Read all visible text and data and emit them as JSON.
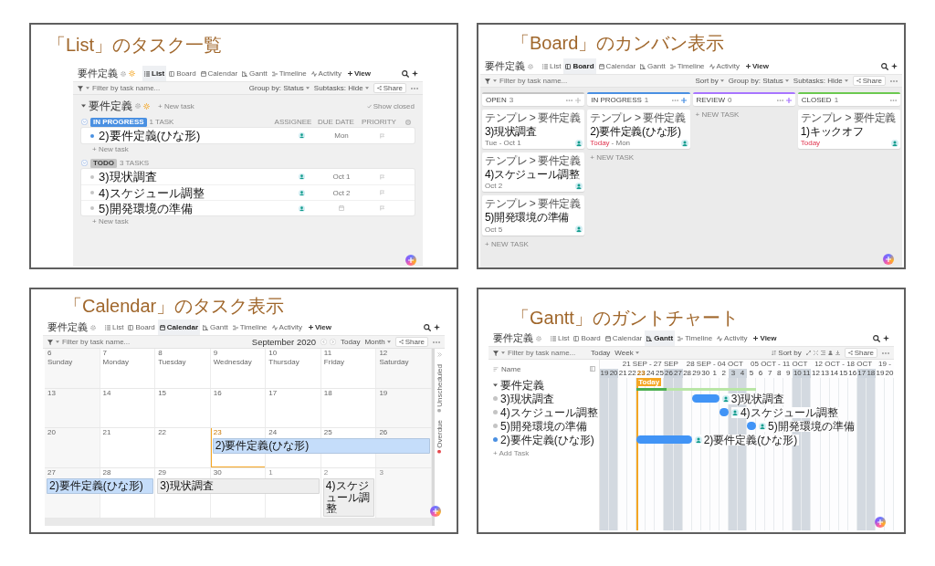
{
  "panels": [
    {
      "kind": "list",
      "title": "「List」のタスク一覧",
      "header": {
        "project": "要件定義",
        "favorite": true,
        "tabs": [
          {
            "kind": "list",
            "label": "List",
            "selected": true
          },
          {
            "kind": "board",
            "label": "Board",
            "selected": false
          },
          {
            "kind": "calendar",
            "label": "Calendar",
            "selected": false
          },
          {
            "kind": "gantt",
            "label": "Gantt",
            "selected": false
          },
          {
            "kind": "timeline",
            "label": "Timeline",
            "selected": false
          },
          {
            "kind": "activity",
            "label": "Activity",
            "selected": false
          }
        ],
        "add_view": "View"
      },
      "toolbar": {
        "filter_placeholder": "Filter by task name...",
        "right": [
          {
            "kind": "dropdown",
            "label": "Group by: Status"
          },
          {
            "kind": "dropdown",
            "label": "Subtasks: Hide"
          },
          {
            "kind": "share",
            "label": "Share"
          },
          {
            "kind": "more"
          }
        ]
      },
      "list": {
        "name": "要件定義",
        "favorite": true,
        "new_task": "+ New task",
        "show_closed": "Show closed",
        "columns": [
          "ASSIGNEE",
          "DUE DATE",
          "PRIORITY"
        ],
        "groups": [
          {
            "status": "IN PROGRESS",
            "color": "#4a90e2",
            "count": "1 TASK",
            "tasks": [
              {
                "name": "2)要件定義(ひな形)",
                "due": "Mon"
              }
            ],
            "new_task": "+ New task"
          },
          {
            "status": "TODO",
            "color": "#c4c4c4",
            "count": "3 TASKS",
            "tasks": [
              {
                "name": "3)現状調査",
                "due": "Oct 1"
              },
              {
                "name": "4)スケジュール調整",
                "due": "Oct 2"
              },
              {
                "name": "5)開発環境の準備"
              }
            ],
            "new_task": "+ New task"
          }
        ]
      }
    },
    {
      "kind": "board",
      "title": "「Board」のカンバン表示",
      "header": {
        "project": "要件定義",
        "favorite": false,
        "tabs": [
          {
            "kind": "list",
            "label": "List",
            "selected": false
          },
          {
            "kind": "board",
            "label": "Board",
            "selected": true
          },
          {
            "kind": "calendar",
            "label": "Calendar",
            "selected": false
          },
          {
            "kind": "gantt",
            "label": "Gantt",
            "selected": false
          },
          {
            "kind": "timeline",
            "label": "Timeline",
            "selected": false
          },
          {
            "kind": "activity",
            "label": "Activity",
            "selected": false
          }
        ],
        "add_view": "View"
      },
      "toolbar": {
        "filter_placeholder": "Filter by task name...",
        "right": [
          {
            "kind": "dropdown",
            "label": "Sort by"
          },
          {
            "kind": "dropdown",
            "label": "Group by: Status"
          },
          {
            "kind": "dropdown",
            "label": "Subtasks: Hide"
          },
          {
            "kind": "share",
            "label": "Share"
          },
          {
            "kind": "more"
          }
        ]
      },
      "board": {
        "columns": [
          {
            "name": "OPEN",
            "count": "3",
            "color": "#c4c4c4",
            "cards": [
              {
                "breadcrumb": "テンプレ > 要件定義",
                "name": "3)現状調査",
                "dates": [
                  {
                    "text": "Tue - Oct 1",
                    "overdue": false
                  }
                ]
              },
              {
                "breadcrumb": "テンプレ > 要件定義",
                "name": "4)スケジュール調整",
                "dates": [
                  {
                    "text": "Oct 2",
                    "overdue": false
                  }
                ]
              },
              {
                "breadcrumb": "テンプレ > 要件定義",
                "name": "5)開発環境の準備",
                "dates": [
                  {
                    "text": "Oct 5",
                    "overdue": false
                  }
                ]
              }
            ],
            "new_task": "+ NEW TASK"
          },
          {
            "name": "IN PROGRESS",
            "count": "1",
            "color": "#4a90e2",
            "cards": [
              {
                "breadcrumb": "テンプレ > 要件定義",
                "name": "2)要件定義(ひな形)",
                "dates": [
                  {
                    "text": "Today",
                    "overdue": true
                  },
                  {
                    "text": "- Mon",
                    "overdue": false
                  }
                ]
              }
            ],
            "new_task": "+ NEW TASK"
          },
          {
            "name": "REVIEW",
            "count": "0",
            "color": "#a875ff",
            "new_task": "+ NEW TASK"
          },
          {
            "name": "CLOSED",
            "count": "1",
            "color": "#6bc950",
            "cards": [
              {
                "breadcrumb": "テンプレ > 要件定義",
                "name": "1)キックオフ",
                "dates": [
                  {
                    "text": "Today",
                    "overdue": true
                  }
                ]
              }
            ]
          }
        ]
      }
    },
    {
      "kind": "calendar",
      "title": "「Calendar」のタスク表示",
      "header": {
        "project": "要件定義",
        "favorite": false,
        "tabs": [
          {
            "kind": "list",
            "label": "List",
            "selected": false
          },
          {
            "kind": "board",
            "label": "Board",
            "selected": false
          },
          {
            "kind": "calendar",
            "label": "Calendar",
            "selected": true
          },
          {
            "kind": "gantt",
            "label": "Gantt",
            "selected": false
          },
          {
            "kind": "timeline",
            "label": "Timeline",
            "selected": false
          },
          {
            "kind": "activity",
            "label": "Activity",
            "selected": false
          }
        ],
        "add_view": "View"
      },
      "toolbar": {
        "filter_placeholder": "Filter by task name...",
        "right": [
          {
            "kind": "heading",
            "label": "September 2020"
          },
          {
            "kind": "pager"
          },
          {
            "kind": "button",
            "label": "Today"
          },
          {
            "kind": "dropdown",
            "label": "Month"
          },
          {
            "kind": "share",
            "label": "Share"
          },
          {
            "kind": "more"
          }
        ]
      },
      "calendar": {
        "weeks": [
          {
            "cells": [
              {
                "kind": "day",
                "date": "6",
                "weekday": "Sunday"
              },
              {
                "kind": "day",
                "date": "7",
                "weekday": "Monday"
              },
              {
                "kind": "day",
                "date": "8",
                "weekday": "Tuesday"
              },
              {
                "kind": "day",
                "date": "9",
                "weekday": "Wednesday"
              },
              {
                "kind": "day",
                "date": "10",
                "weekday": "Thursday"
              },
              {
                "kind": "day",
                "date": "11",
                "weekday": "Friday"
              },
              {
                "kind": "day",
                "date": "12",
                "weekday": "Saturday"
              }
            ]
          },
          {
            "cells": [
              {
                "kind": "day",
                "date": "13"
              },
              {
                "kind": "day",
                "date": "14"
              },
              {
                "kind": "day",
                "date": "15"
              },
              {
                "kind": "day",
                "date": "16"
              },
              {
                "kind": "day",
                "date": "17"
              },
              {
                "kind": "day",
                "date": "18"
              },
              {
                "kind": "day",
                "date": "19"
              }
            ]
          },
          {
            "cells": [
              {
                "kind": "day",
                "date": "20"
              },
              {
                "kind": "day",
                "date": "21"
              },
              {
                "kind": "day",
                "date": "22"
              },
              {
                "kind": "event",
                "title": "2)要件定義(ひな形)",
                "color": "#c5ddfa",
                "days": [
                  {
                    "kind": "today",
                    "date": "23"
                  },
                  {
                    "kind": "day",
                    "date": "24"
                  },
                  {
                    "kind": "day",
                    "date": "25"
                  },
                  {
                    "kind": "day",
                    "date": "26"
                  }
                ]
              }
            ]
          },
          {
            "cells": [
              {
                "kind": "event",
                "title": "2)要件定義(ひな形)",
                "color": "#c5ddfa",
                "days": [
                  {
                    "kind": "day",
                    "date": "27"
                  },
                  {
                    "kind": "day",
                    "date": "28"
                  }
                ]
              },
              {
                "kind": "event",
                "title": "3)現状調査",
                "color": "#eeeeee",
                "days": [
                  {
                    "kind": "day",
                    "date": "29"
                  },
                  {
                    "kind": "day",
                    "date": "30"
                  },
                  {
                    "kind": "outside",
                    "date": "1"
                  }
                ]
              },
              {
                "kind": "event",
                "title": "4)スケジュール調整",
                "color": "#eeeeee",
                "days": [
                  {
                    "kind": "outside",
                    "date": "2"
                  }
                ]
              },
              {
                "kind": "outside",
                "date": "3"
              }
            ]
          }
        ],
        "side_tabs": [
          {
            "label": "Unscheduled",
            "color": "#b0b0b0"
          },
          {
            "label": "Overdue",
            "color": "#e5484d"
          }
        ]
      }
    },
    {
      "kind": "gantt",
      "title": "「Gantt」のガントチャート",
      "header": {
        "project": "要件定義",
        "favorite": false,
        "tabs": [
          {
            "kind": "list",
            "label": "List",
            "selected": false
          },
          {
            "kind": "board",
            "label": "Board",
            "selected": false
          },
          {
            "kind": "calendar",
            "label": "Calendar",
            "selected": false
          },
          {
            "kind": "gantt",
            "label": "Gantt",
            "selected": true
          },
          {
            "kind": "timeline",
            "label": "Timeline",
            "selected": false
          },
          {
            "kind": "activity",
            "label": "Activity",
            "selected": false
          }
        ],
        "add_view": "View"
      },
      "toolbar": {
        "filter_placeholder": "Filter by task name...",
        "left": [
          {
            "kind": "button",
            "label": "Today"
          },
          {
            "kind": "dropdown",
            "label": "Week"
          }
        ],
        "right": [
          {
            "kind": "sort",
            "label": "Sort by"
          },
          {
            "kind": "tools"
          },
          {
            "kind": "share",
            "label": "Share"
          },
          {
            "kind": "more"
          }
        ]
      },
      "gantt": {
        "name_header": "Name",
        "today_label": "Today",
        "weeks": [
          {
            "days": [
              {
                "date": "19",
                "kind": "weekend"
              },
              {
                "date": "20",
                "kind": "weekend"
              }
            ]
          },
          {
            "label": "21 SEP - 27 SEP",
            "days": [
              {
                "date": "21",
                "kind": "weekday"
              },
              {
                "date": "22",
                "kind": "weekday"
              },
              {
                "date": "23",
                "kind": "today"
              },
              {
                "date": "24",
                "kind": "weekday"
              },
              {
                "date": "25",
                "kind": "weekday"
              },
              {
                "date": "26",
                "kind": "weekend"
              },
              {
                "date": "27",
                "kind": "weekend"
              }
            ]
          },
          {
            "label": "28 SEP - 04 OCT",
            "days": [
              {
                "date": "28",
                "kind": "weekday"
              },
              {
                "date": "29",
                "kind": "weekday"
              },
              {
                "date": "30",
                "kind": "weekday"
              },
              {
                "date": "1",
                "kind": "weekday"
              },
              {
                "date": "2",
                "kind": "weekday"
              },
              {
                "date": "3",
                "kind": "weekend"
              },
              {
                "date": "4",
                "kind": "weekend"
              }
            ]
          },
          {
            "label": "05 OCT - 11 OCT",
            "days": [
              {
                "date": "5",
                "kind": "weekday"
              },
              {
                "date": "6",
                "kind": "weekday"
              },
              {
                "date": "7",
                "kind": "weekday"
              },
              {
                "date": "8",
                "kind": "weekday"
              },
              {
                "date": "9",
                "kind": "weekday"
              },
              {
                "date": "10",
                "kind": "weekend"
              },
              {
                "date": "11",
                "kind": "weekend"
              }
            ]
          },
          {
            "label": "12 OCT - 18 OCT",
            "days": [
              {
                "date": "12",
                "kind": "weekday"
              },
              {
                "date": "13",
                "kind": "weekday"
              },
              {
                "date": "14",
                "kind": "weekday"
              },
              {
                "date": "15",
                "kind": "weekday"
              },
              {
                "date": "16",
                "kind": "weekday"
              },
              {
                "date": "17",
                "kind": "weekend"
              },
              {
                "date": "18",
                "kind": "weekend"
              }
            ]
          },
          {
            "label": "19 -",
            "days": [
              {
                "date": "19",
                "kind": "weekday"
              },
              {
                "date": "20",
                "kind": "weekday"
              }
            ]
          }
        ],
        "rows": [
          {
            "kind": "group",
            "name": "要件定義",
            "segments": [
              {
                "kind": "gap",
                "days": [
                  {
                    "weekend": true
                  },
                  {
                    "weekend": true
                  },
                  {
                    "weekend": false
                  },
                  {
                    "weekend": false
                  }
                ]
              },
              {
                "kind": "bar",
                "level": 0.25,
                "days": [
                  {
                    "weekend": false
                  },
                  {
                    "weekend": false
                  },
                  {
                    "weekend": false
                  },
                  {
                    "weekend": true
                  },
                  {
                    "weekend": true
                  },
                  {
                    "weekend": false
                  },
                  {
                    "weekend": false
                  },
                  {
                    "weekend": false
                  },
                  {
                    "weekend": false
                  },
                  {
                    "weekend": false
                  },
                  {
                    "weekend": true
                  },
                  {
                    "weekend": true
                  },
                  {
                    "weekend": false
                  }
                ]
              },
              {
                "kind": "gap",
                "days": [
                  {
                    "weekend": false
                  },
                  {
                    "weekend": false
                  },
                  {
                    "weekend": false
                  },
                  {
                    "weekend": false
                  },
                  {
                    "weekend": true
                  },
                  {
                    "weekend": true
                  },
                  {
                    "weekend": false
                  },
                  {
                    "weekend": false
                  },
                  {
                    "weekend": false
                  },
                  {
                    "weekend": false
                  },
                  {
                    "weekend": false
                  },
                  {
                    "weekend": true
                  },
                  {
                    "weekend": true
                  },
                  {
                    "weekend": false
                  },
                  {
                    "weekend": false
                  }
                ]
              }
            ]
          },
          {
            "kind": "task",
            "name": "3)現状調査",
            "color": "#c4c4c4",
            "segments": [
              {
                "kind": "gap",
                "days": [
                  {
                    "weekend": true
                  },
                  {
                    "weekend": true
                  },
                  {
                    "weekend": false
                  },
                  {
                    "weekend": false
                  },
                  {
                    "weekend": false
                  },
                  {
                    "weekend": false
                  },
                  {
                    "weekend": false
                  },
                  {
                    "weekend": true
                  },
                  {
                    "weekend": true
                  },
                  {
                    "weekend": false
                  }
                ]
              },
              {
                "kind": "bar",
                "label": "3)現状調査",
                "days": [
                  {
                    "weekend": false
                  },
                  {
                    "weekend": false
                  },
                  {
                    "weekend": false
                  }
                ]
              },
              {
                "kind": "gap",
                "days": [
                  {
                    "weekend": false
                  },
                  {
                    "weekend": true
                  },
                  {
                    "weekend": true
                  },
                  {
                    "weekend": false
                  },
                  {
                    "weekend": false
                  },
                  {
                    "weekend": false
                  },
                  {
                    "weekend": false
                  },
                  {
                    "weekend": false
                  },
                  {
                    "weekend": true
                  },
                  {
                    "weekend": true
                  },
                  {
                    "weekend": false
                  },
                  {
                    "weekend": false
                  },
                  {
                    "weekend": false
                  },
                  {
                    "weekend": false
                  },
                  {
                    "weekend": false
                  },
                  {
                    "weekend": true
                  },
                  {
                    "weekend": true
                  },
                  {
                    "weekend": false
                  },
                  {
                    "weekend": false
                  }
                ]
              }
            ]
          },
          {
            "kind": "task",
            "name": "4)スケジュール調整",
            "color": "#c4c4c4",
            "segments": [
              {
                "kind": "gap",
                "days": [
                  {
                    "weekend": true
                  },
                  {
                    "weekend": true
                  },
                  {
                    "weekend": false
                  },
                  {
                    "weekend": false
                  },
                  {
                    "weekend": false
                  },
                  {
                    "weekend": false
                  },
                  {
                    "weekend": false
                  },
                  {
                    "weekend": true
                  },
                  {
                    "weekend": true
                  },
                  {
                    "weekend": false
                  },
                  {
                    "weekend": false
                  },
                  {
                    "weekend": false
                  },
                  {
                    "weekend": false
                  }
                ]
              },
              {
                "kind": "bar",
                "label": "4)スケジュール調整",
                "days": [
                  {
                    "weekend": false
                  }
                ]
              },
              {
                "kind": "gap",
                "days": [
                  {
                    "weekend": true
                  },
                  {
                    "weekend": true
                  },
                  {
                    "weekend": false
                  },
                  {
                    "weekend": false
                  },
                  {
                    "weekend": false
                  },
                  {
                    "weekend": false
                  },
                  {
                    "weekend": false
                  },
                  {
                    "weekend": true
                  },
                  {
                    "weekend": true
                  },
                  {
                    "weekend": false
                  },
                  {
                    "weekend": false
                  },
                  {
                    "weekend": false
                  },
                  {
                    "weekend": false
                  },
                  {
                    "weekend": false
                  },
                  {
                    "weekend": true
                  },
                  {
                    "weekend": true
                  },
                  {
                    "weekend": false
                  },
                  {
                    "weekend": false
                  }
                ]
              }
            ]
          },
          {
            "kind": "task",
            "name": "5)開発環境の準備",
            "color": "#c4c4c4",
            "segments": [
              {
                "kind": "gap",
                "days": [
                  {
                    "weekend": true
                  },
                  {
                    "weekend": true
                  },
                  {
                    "weekend": false
                  },
                  {
                    "weekend": false
                  },
                  {
                    "weekend": false
                  },
                  {
                    "weekend": false
                  },
                  {
                    "weekend": false
                  },
                  {
                    "weekend": true
                  },
                  {
                    "weekend": true
                  },
                  {
                    "weekend": false
                  },
                  {
                    "weekend": false
                  },
                  {
                    "weekend": false
                  },
                  {
                    "weekend": false
                  },
                  {
                    "weekend": false
                  },
                  {
                    "weekend": true
                  },
                  {
                    "weekend": true
                  }
                ]
              },
              {
                "kind": "bar",
                "label": "5)開発環境の準備",
                "days": [
                  {
                    "weekend": false
                  }
                ]
              },
              {
                "kind": "gap",
                "days": [
                  {
                    "weekend": false
                  },
                  {
                    "weekend": false
                  },
                  {
                    "weekend": false
                  },
                  {
                    "weekend": false
                  },
                  {
                    "weekend": true
                  },
                  {
                    "weekend": true
                  },
                  {
                    "weekend": false
                  },
                  {
                    "weekend": false
                  },
                  {
                    "weekend": false
                  },
                  {
                    "weekend": false
                  },
                  {
                    "weekend": false
                  },
                  {
                    "weekend": true
                  },
                  {
                    "weekend": true
                  },
                  {
                    "weekend": false
                  },
                  {
                    "weekend": false
                  }
                ]
              }
            ]
          },
          {
            "kind": "task",
            "name": "2)要件定義(ひな形)",
            "color": "#4a90e2",
            "segments": [
              {
                "kind": "gap",
                "days": [
                  {
                    "weekend": true
                  },
                  {
                    "weekend": true
                  },
                  {
                    "weekend": false
                  },
                  {
                    "weekend": false
                  }
                ]
              },
              {
                "kind": "bar",
                "label": "2)要件定義(ひな形)",
                "days": [
                  {
                    "weekend": false
                  },
                  {
                    "weekend": false
                  },
                  {
                    "weekend": false
                  },
                  {
                    "weekend": true
                  },
                  {
                    "weekend": true
                  },
                  {
                    "weekend": false
                  }
                ]
              },
              {
                "kind": "gap",
                "days": [
                  {
                    "weekend": false
                  },
                  {
                    "weekend": false
                  },
                  {
                    "weekend": false
                  },
                  {
                    "weekend": false
                  },
                  {
                    "weekend": true
                  },
                  {
                    "weekend": true
                  },
                  {
                    "weekend": false
                  },
                  {
                    "weekend": false
                  },
                  {
                    "weekend": false
                  },
                  {
                    "weekend": false
                  },
                  {
                    "weekend": false
                  },
                  {
                    "weekend": true
                  },
                  {
                    "weekend": true
                  },
                  {
                    "weekend": false
                  },
                  {
                    "weekend": false
                  },
                  {
                    "weekend": false
                  },
                  {
                    "weekend": false
                  },
                  {
                    "weekend": false
                  },
                  {
                    "weekend": true
                  },
                  {
                    "weekend": true
                  },
                  {
                    "weekend": false
                  },
                  {
                    "weekend": false
                  }
                ]
              }
            ]
          }
        ],
        "add_task": "+ Add Task"
      }
    }
  ]
}
